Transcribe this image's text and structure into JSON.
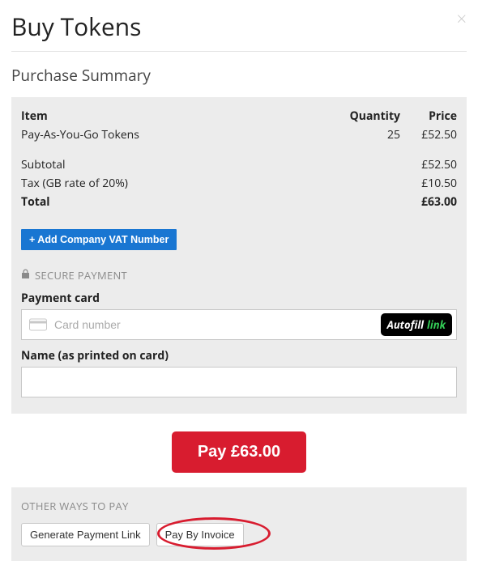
{
  "header": {
    "title": "Buy Tokens",
    "close_glyph": "×"
  },
  "summary": {
    "section_title": "Purchase Summary",
    "col_item": "Item",
    "col_qty": "Quantity",
    "col_price": "Price",
    "line_item_name": "Pay-As-You-Go Tokens",
    "line_item_qty": "25",
    "line_item_price": "£52.50",
    "subtotal_label": "Subtotal",
    "subtotal_value": "£52.50",
    "tax_label": "Tax (GB rate of 20%)",
    "tax_value": "£10.50",
    "total_label": "Total",
    "total_value": "£63.00",
    "vat_button": "+ Add Company VAT Number"
  },
  "payment": {
    "secure_label": "SECURE PAYMENT",
    "card_label": "Payment card",
    "card_placeholder": "Card number",
    "autofill_text": "Autofill",
    "autofill_link": "link",
    "name_label": "Name (as printed on card)",
    "pay_button": "Pay £63.00"
  },
  "other": {
    "title": "OTHER WAYS TO PAY",
    "gen_link_button": "Generate Payment Link",
    "invoice_button": "Pay By Invoice"
  }
}
